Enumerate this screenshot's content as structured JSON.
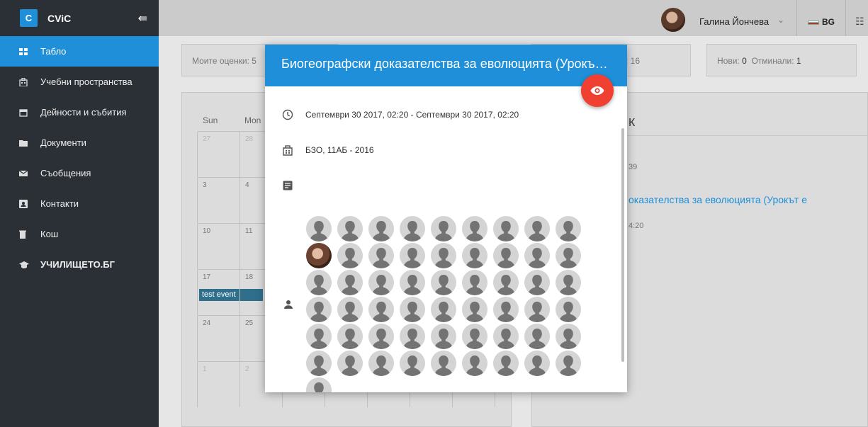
{
  "sidebar": {
    "logo_letter": "C",
    "title": "CViC",
    "collapse_icon": "collapse-arrow-icon",
    "items": [
      {
        "label": "Табло",
        "icon": "dashboard-icon",
        "active": true
      },
      {
        "label": "Учебни пространства",
        "icon": "building-icon"
      },
      {
        "label": "Дейности и събития",
        "icon": "calendar-icon"
      },
      {
        "label": "Документи",
        "icon": "folder-icon"
      },
      {
        "label": "Съобщения",
        "icon": "mail-icon"
      },
      {
        "label": "Контакти",
        "icon": "contact-card-icon"
      },
      {
        "label": "Кош",
        "icon": "trash-icon"
      },
      {
        "label": "УЧИЛИЩЕТО.БГ",
        "icon": "school-icon"
      }
    ]
  },
  "topbar": {
    "user_name": "Галина Йончева",
    "language": "BG"
  },
  "stats": {
    "grades": "Моите оценки: 5",
    "partial": ": 16",
    "new_label": "Нови:",
    "new_value": "0",
    "missed_label": "Отминали:",
    "missed_value": "1"
  },
  "calendar": {
    "headers": [
      "Sun",
      "Mon"
    ],
    "rows": [
      [
        "27",
        "28"
      ],
      [
        "3",
        "4"
      ],
      [
        "10",
        "11"
      ],
      [
        "17",
        "18"
      ],
      [
        "24",
        "25"
      ],
      [
        "1",
        "2"
      ]
    ],
    "event": "test event"
  },
  "right_panel": {
    "title": "К",
    "time1": "39",
    "link": "оказателства за еволюцията (Урокът е",
    "time2": "4:20"
  },
  "modal": {
    "title": "Биогеографски доказателства за еволюцията (Урокът е",
    "datetime": "Септември 30 2017, 02:20 - Септември 30 2017, 02:20",
    "location": "БЗО, 11АБ - 2016",
    "participants_count": 55,
    "colors": {
      "header": "#1e8fd8",
      "fab": "#f04032"
    }
  }
}
